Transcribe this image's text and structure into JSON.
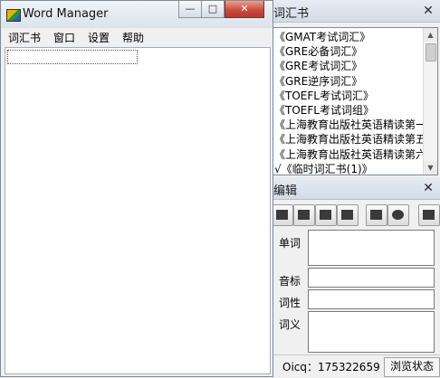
{
  "main_window": {
    "title": "Word Manager",
    "controls": {
      "minimize": "—",
      "maximize": "□",
      "close": "✕"
    },
    "menu": [
      "词汇书",
      "窗口",
      "设置",
      "帮助"
    ]
  },
  "vocab_panel": {
    "title": "词汇书",
    "close": "✕",
    "items": [
      "《GMAT考试词汇》",
      "《GRE必备词汇》",
      "《GRE考试词汇》",
      "《GRE逆序词汇》",
      "《TOEFL考试词汇》",
      "《TOEFL考试词组》",
      "《上海教育出版社英语精读第一",
      "《上海教育出版社英语精读第五",
      "《上海教育出版社英语精读第六",
      "√《临时词汇书(1)》"
    ]
  },
  "edit_panel": {
    "title": "编辑",
    "close": "✕",
    "fields": {
      "word": "单词",
      "phonetic": "音标",
      "part_of_speech": "词性",
      "meaning": "词义"
    }
  },
  "statusbar": {
    "oicq": "Oicq：175322659",
    "mode": "浏览状态"
  },
  "icons": {
    "scroll_up": "▲",
    "scroll_down": "▼"
  }
}
